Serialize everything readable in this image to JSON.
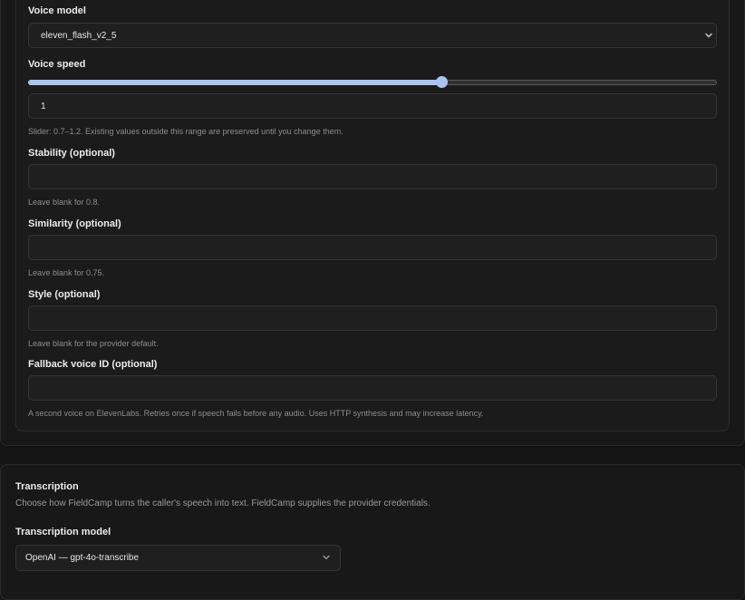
{
  "voice_model": {
    "label": "Voice model",
    "selected": "eleven_flash_v2_5"
  },
  "voice_speed": {
    "label": "Voice speed",
    "slider_fraction": 0.6,
    "value": "1",
    "hint": "Slider: 0.7–1.2. Existing values outside this range are preserved until you change them."
  },
  "stability": {
    "label": "Stability (optional)",
    "value": "",
    "hint": "Leave blank for 0.8."
  },
  "similarity": {
    "label": "Similarity (optional)",
    "value": "",
    "hint": "Leave blank for 0.75."
  },
  "style": {
    "label": "Style (optional)",
    "value": "",
    "hint": "Leave blank for the provider default."
  },
  "fallback_voice": {
    "label": "Fallback voice ID (optional)",
    "value": "",
    "hint": "A second voice on ElevenLabs. Retries once if speech fails before any audio. Uses HTTP synthesis and may increase latency."
  },
  "transcription": {
    "title": "Transcription",
    "description": "Choose how FieldCamp turns the caller's speech into text. FieldCamp supplies the provider credentials.",
    "model_label": "Transcription model",
    "model_selected": "OpenAI — gpt-4o-transcribe"
  },
  "colors": {
    "accent": "#a9c4ef",
    "background": "#141414"
  }
}
